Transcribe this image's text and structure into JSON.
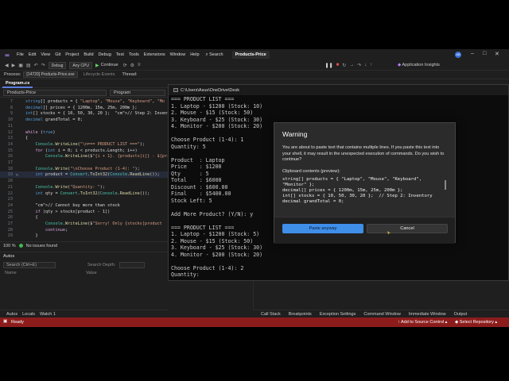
{
  "menubar": {
    "items": [
      "File",
      "Edit",
      "View",
      "Git",
      "Project",
      "Build",
      "Debug",
      "Test",
      "Tools",
      "Extensions",
      "Window",
      "Help"
    ],
    "search_label": "Search",
    "solution_name": "Products-Price",
    "badge": "AB"
  },
  "toolbar": {
    "config": "Debug",
    "platform": "Any CPU",
    "continue_label": "Continue",
    "app_insights": "Application Insights"
  },
  "procbar": {
    "process_label": "Process:",
    "process_value": "[14720] Products-Price.exe",
    "lifecycle": "Lifecycle Events",
    "thread_label": "Thread:"
  },
  "editor": {
    "tab": "Program.cs",
    "nav_left": "Products-Price",
    "nav_right": "Program",
    "zoom": "100 %",
    "issues": "No issues found",
    "lines": [
      {
        "n": "7",
        "t": "string[] products = { \"Laptop\", \"Mouse\", \"Keyboard\", \"Mo"
      },
      {
        "n": "8",
        "t": "decimal[] prices = { 1200m, 15m, 25m, 200m };"
      },
      {
        "n": "9",
        "t": "int[] stocks = { 10, 50, 30, 20 };  // Step 2: Inventory"
      },
      {
        "n": "10",
        "t": "decimal grandTotal = 0;"
      },
      {
        "n": "11",
        "t": ""
      },
      {
        "n": "12",
        "t": "while (true)"
      },
      {
        "n": "13",
        "t": "{"
      },
      {
        "n": "14",
        "t": "    Console.WriteLine(\"\\n=== PRODUCT LIST ===\");"
      },
      {
        "n": "15",
        "t": "    for (int i = 0; i < products.Length; i++)"
      },
      {
        "n": "16",
        "t": "        Console.WriteLine($\"{i + 1}. {products[i]} - ${pri"
      },
      {
        "n": "17",
        "t": ""
      },
      {
        "n": "18",
        "t": "    Console.Write(\"\\nChoose Product (1-4): \");"
      },
      {
        "n": "19",
        "t": "    int product = Convert.ToInt32(Console.ReadLine());"
      },
      {
        "n": "20",
        "t": ""
      },
      {
        "n": "21",
        "t": "    Console.Write(\"Quantity: \");"
      },
      {
        "n": "22",
        "t": "    int qty = Convert.ToInt32(Console.ReadLine());"
      },
      {
        "n": "23",
        "t": ""
      },
      {
        "n": "24",
        "t": "    // Cannot buy more than stock"
      },
      {
        "n": "25",
        "t": "    if (qty > stocks[product - 1])"
      },
      {
        "n": "26",
        "t": "    {"
      },
      {
        "n": "27",
        "t": "        Console.WriteLine($\"Sorry! Only {stocks[product"
      },
      {
        "n": "28",
        "t": "        continue;"
      },
      {
        "n": "29",
        "t": "    }"
      }
    ]
  },
  "autos": {
    "title": "Autos",
    "search_placeholder": "Search (Ctrl+E)",
    "depth_label": "Search Depth:",
    "col_name": "Name",
    "col_value": "Value"
  },
  "bottom_tabs_left": [
    "Autos",
    "Locals",
    "Watch 1"
  ],
  "bottom_tabs_right": [
    "Call Stack",
    "Breakpoints",
    "Exception Settings",
    "Command Window",
    "Immediate Window",
    "Output"
  ],
  "statusbar": {
    "ready": "Ready",
    "add_source": "Add to Source Control",
    "select_repo": "Select Repository"
  },
  "terminal": {
    "title": "C:\\Users\\Asus\\OneDrive\\Desk",
    "lines": [
      "=== PRODUCT LIST ===",
      "1. Laptop - $1200 (Stock: 10)",
      "2. Mouse - $15 (Stock: 50)",
      "3. Keyboard - $25 (Stock: 30)",
      "4. Monitor - $200 (Stock: 20)",
      "",
      "Choose Product (1-4): 1",
      "Quantity: 5",
      "",
      "Product  : Laptop",
      "Price    : $1200",
      "Qty      : 5",
      "Total    : $6000",
      "Discount : $600.00",
      "Final    : $5400.00",
      "Stock Left: 5",
      "",
      "Add More Product? (Y/N): y",
      "",
      "=== PRODUCT LIST ===",
      "1. Laptop - $1200 (Stock: 5)",
      "2. Mouse - $15 (Stock: 50)",
      "3. Keyboard - $25 (Stock: 30)",
      "4. Monitor - $200 (Stock: 20)",
      "",
      "Choose Product (1-4): 2",
      "Quantity:"
    ]
  },
  "dialog": {
    "title": "Warning",
    "message": "You are about to paste text that contains multiple lines. If you paste this text into your shell, it may result in the unexpected execution of commands. Do you wish to continue?",
    "clipboard_label": "Clipboard contents (preview):",
    "preview": [
      "string[] products = { \"Laptop\", \"Mouse\", \"Keyboard\", \"Monitor\" };",
      "decimal[] prices = { 1200m, 15m, 25m, 200m };",
      "int[] stocks = { 10, 50, 30, 20 };  // Step 2: Inventory",
      "decimal grandTotal = 0;"
    ],
    "paste_label": "Paste anyway",
    "cancel_label": "Cancel"
  }
}
